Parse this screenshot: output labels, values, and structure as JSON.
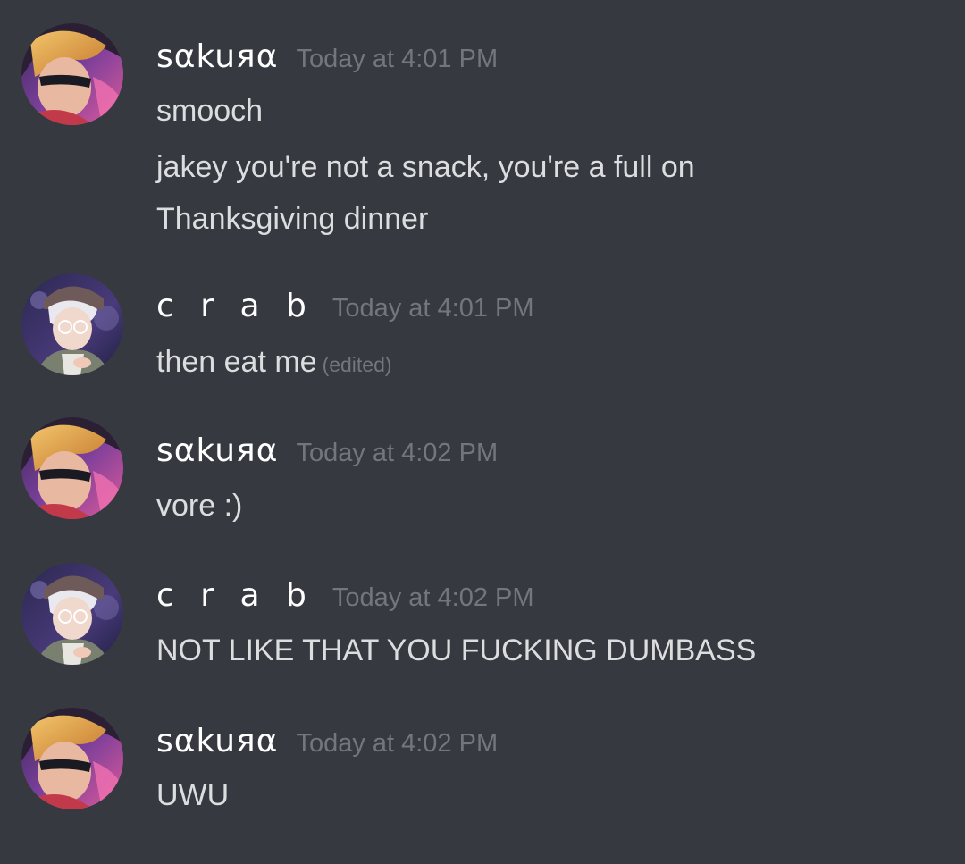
{
  "messages": [
    {
      "author": "sαkuяα",
      "timestamp": "Today at 4:01 PM",
      "lines": [
        "smooch",
        "jakey you're not a snack, you're a full on",
        "Thanksgiving dinner"
      ]
    },
    {
      "author": "c r a b",
      "timestamp": "Today at 4:01 PM",
      "lines": [
        "then eat me"
      ],
      "edited": "(edited)"
    },
    {
      "author": "sαkuяα",
      "timestamp": "Today at 4:02 PM",
      "lines": [
        "vore :)"
      ]
    },
    {
      "author": "c r a b",
      "timestamp": "Today at 4:02 PM",
      "lines": [
        "NOT LIKE THAT YOU FUCKING DUMBASS"
      ]
    },
    {
      "author": "sαkuяα",
      "timestamp": "Today at 4:02 PM",
      "lines": [
        "UWU"
      ]
    }
  ],
  "theme": {
    "background": "#36393f",
    "username_color": "#ffffff",
    "timestamp_color": "#72767d",
    "text_color": "#dcddde"
  }
}
